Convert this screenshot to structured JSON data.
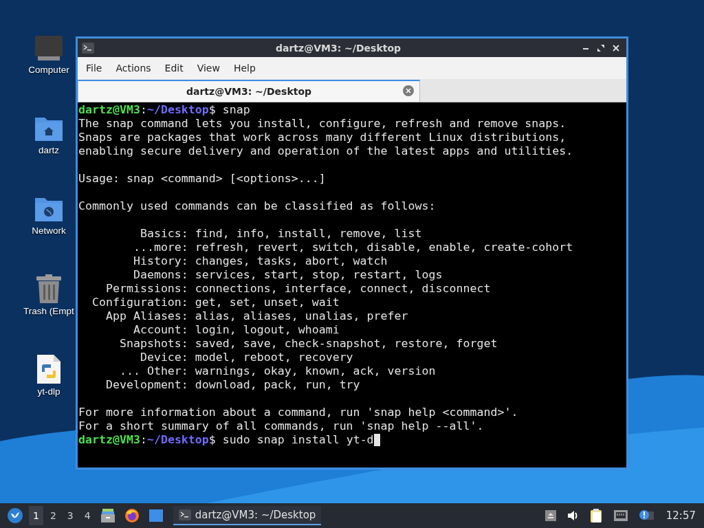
{
  "desktop_icons": [
    {
      "label": "Computer",
      "kind": "computer"
    },
    {
      "label": "dartz",
      "kind": "home"
    },
    {
      "label": "Network",
      "kind": "network"
    },
    {
      "label": "Trash (Empt",
      "kind": "trash"
    },
    {
      "label": "yt-dlp",
      "kind": "python"
    }
  ],
  "window": {
    "title": "dartz@VM3: ~/Desktop",
    "menu": [
      "File",
      "Actions",
      "Edit",
      "View",
      "Help"
    ],
    "tabs": [
      {
        "label": "dartz@VM3: ~/Desktop",
        "selected": true
      }
    ],
    "terminal_lines": [
      {
        "kind": "prompt",
        "user": "dartz@VM3",
        "separator": ":",
        "path": "~/Desktop",
        "symbol": "$",
        "command": "snap",
        "cursor": false
      },
      {
        "kind": "text",
        "text": "The snap command lets you install, configure, refresh and remove snaps."
      },
      {
        "kind": "text",
        "text": "Snaps are packages that work across many different Linux distributions,"
      },
      {
        "kind": "text",
        "text": "enabling secure delivery and operation of the latest apps and utilities."
      },
      {
        "kind": "blank"
      },
      {
        "kind": "text",
        "text": "Usage: snap <command> [<options>...]"
      },
      {
        "kind": "blank"
      },
      {
        "kind": "text",
        "text": "Commonly used commands can be classified as follows:"
      },
      {
        "kind": "blank"
      },
      {
        "kind": "text",
        "text": "         Basics: find, info, install, remove, list"
      },
      {
        "kind": "text",
        "text": "        ...more: refresh, revert, switch, disable, enable, create-cohort"
      },
      {
        "kind": "text",
        "text": "        History: changes, tasks, abort, watch"
      },
      {
        "kind": "text",
        "text": "        Daemons: services, start, stop, restart, logs"
      },
      {
        "kind": "text",
        "text": "    Permissions: connections, interface, connect, disconnect"
      },
      {
        "kind": "text",
        "text": "  Configuration: get, set, unset, wait"
      },
      {
        "kind": "text",
        "text": "    App Aliases: alias, aliases, unalias, prefer"
      },
      {
        "kind": "text",
        "text": "        Account: login, logout, whoami"
      },
      {
        "kind": "text",
        "text": "      Snapshots: saved, save, check-snapshot, restore, forget"
      },
      {
        "kind": "text",
        "text": "         Device: model, reboot, recovery"
      },
      {
        "kind": "text",
        "text": "      ... Other: warnings, okay, known, ack, version"
      },
      {
        "kind": "text",
        "text": "    Development: download, pack, run, try"
      },
      {
        "kind": "blank"
      },
      {
        "kind": "text",
        "text": "For more information about a command, run 'snap help <command>'."
      },
      {
        "kind": "text",
        "text": "For a short summary of all commands, run 'snap help --all'."
      },
      {
        "kind": "prompt",
        "user": "dartz@VM3",
        "separator": ":",
        "path": "~/Desktop",
        "symbol": "$",
        "command": "sudo snap install yt-d",
        "cursor": true
      }
    ]
  },
  "taskbar": {
    "workspaces": [
      {
        "label": "1",
        "selected": true
      },
      {
        "label": "2",
        "selected": false
      },
      {
        "label": "3",
        "selected": false
      },
      {
        "label": "4",
        "selected": false
      }
    ],
    "tasks": [
      {
        "label": "dartz@VM3: ~/Desktop",
        "selected": true
      }
    ],
    "clock": "12:57"
  }
}
